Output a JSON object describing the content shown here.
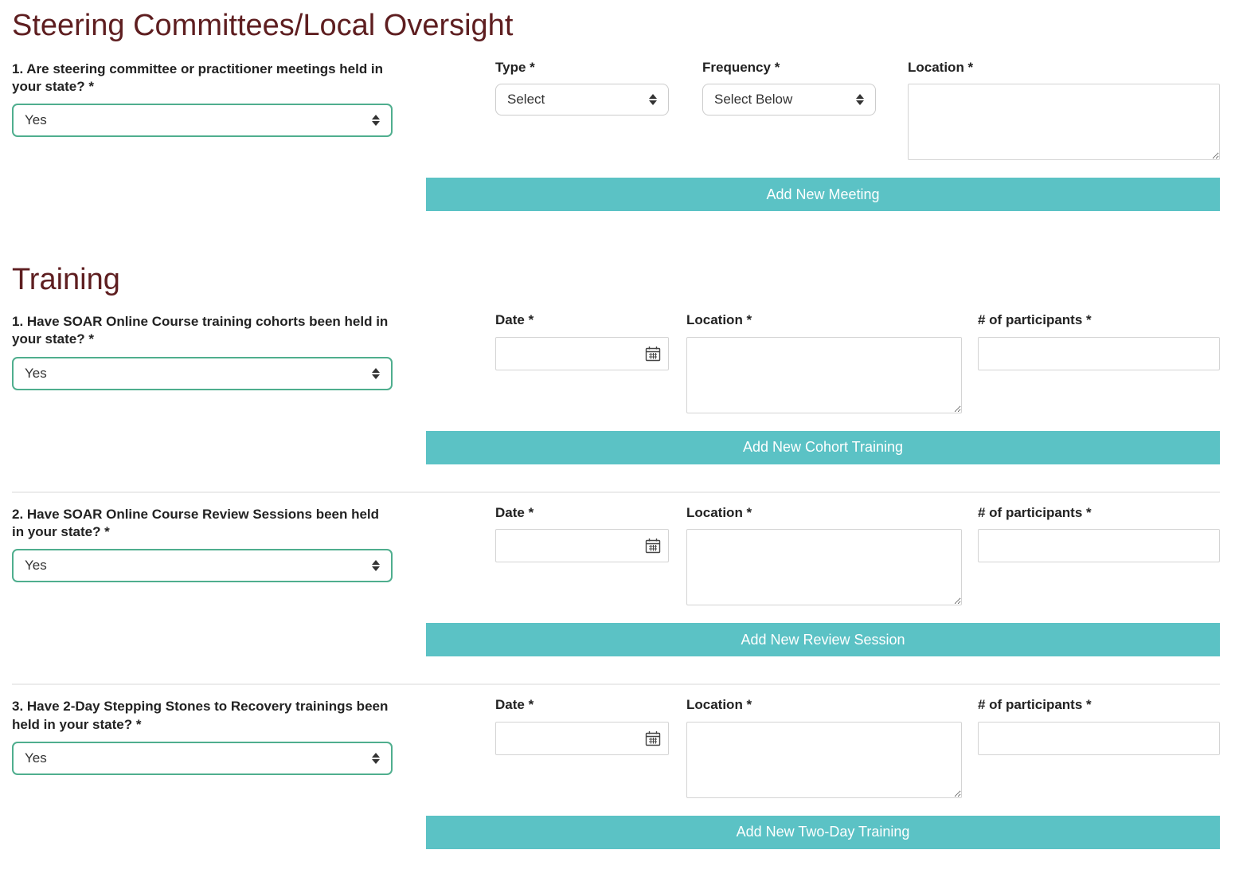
{
  "colors": {
    "heading_maroon": "#5e1e20",
    "button_teal": "#5bc2c5",
    "select_border_green": "#4fae8e"
  },
  "icons": {
    "calendar": "calendar-icon",
    "select_stepper": "up-down-arrows-icon"
  },
  "steering_section": {
    "title": "Steering Committees/Local Oversight",
    "question": {
      "label": "1. Are steering committee or practitioner meetings held in your state? *",
      "value": "Yes"
    },
    "type": {
      "label": "Type *",
      "value": "Select"
    },
    "frequency": {
      "label": "Frequency *",
      "value": "Select Below"
    },
    "location": {
      "label": "Location *",
      "value": ""
    },
    "add_button": "Add New Meeting"
  },
  "training_section": {
    "title": "Training",
    "questions": [
      {
        "label": "1. Have SOAR Online Course training cohorts been held in your state? *",
        "value": "Yes",
        "date_label": "Date *",
        "date_value": "",
        "location_label": "Location *",
        "location_value": "",
        "participants_label": "# of participants *",
        "participants_value": "",
        "add_button": "Add New Cohort Training"
      },
      {
        "label": "2. Have SOAR Online Course Review Sessions been held in your state? *",
        "value": "Yes",
        "date_label": "Date *",
        "date_value": "",
        "location_label": "Location *",
        "location_value": "",
        "participants_label": "# of participants *",
        "participants_value": "",
        "add_button": "Add New Review Session"
      },
      {
        "label": "3. Have 2-Day Stepping Stones to Recovery trainings been held in your state? *",
        "value": "Yes",
        "date_label": "Date *",
        "date_value": "",
        "location_label": "Location *",
        "location_value": "",
        "participants_label": "# of participants *",
        "participants_value": "",
        "add_button": "Add New Two-Day Training"
      }
    ]
  }
}
